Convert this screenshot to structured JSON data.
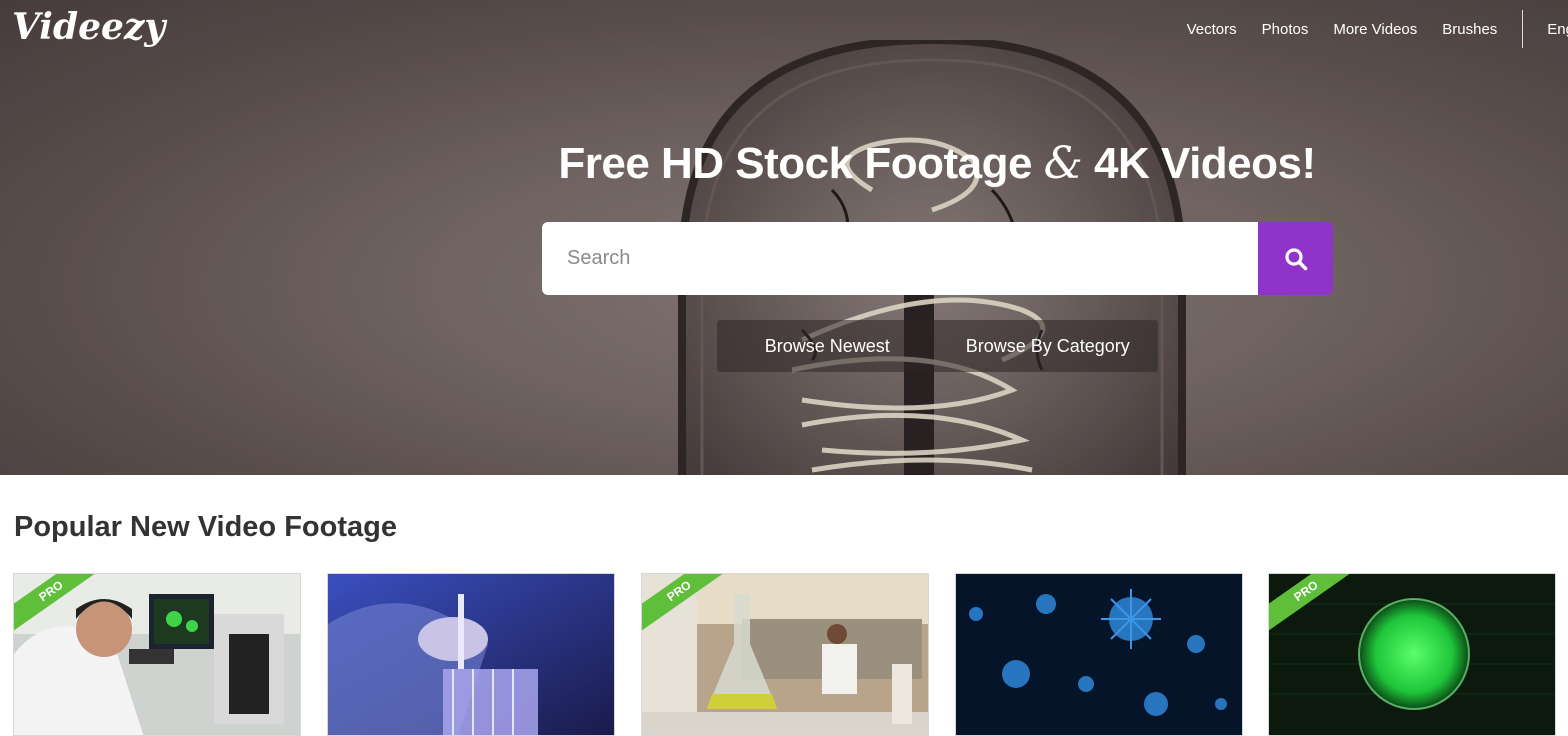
{
  "site": {
    "logo": "Videezy"
  },
  "nav": {
    "links": [
      "Vectors",
      "Photos",
      "More Videos",
      "Brushes"
    ],
    "language": "Eng"
  },
  "hero": {
    "headline_pre": "Free HD Stock Footage ",
    "headline_amp": "&",
    "headline_post": " 4K Videos!",
    "search_placeholder": "Search",
    "browse_newest": "Browse Newest",
    "browse_category": "Browse By Category"
  },
  "section": {
    "title": "Popular New Video Footage",
    "thumbnails": [
      {
        "subject": "scientist at microscope",
        "badge": "PRO"
      },
      {
        "subject": "pipette into test tubes",
        "badge": ""
      },
      {
        "subject": "laboratory flask",
        "badge": "PRO"
      },
      {
        "subject": "blue virus particles",
        "badge": ""
      },
      {
        "subject": "green cell sphere",
        "badge": "PRO"
      }
    ]
  },
  "colors": {
    "accent": "#8f33c9",
    "pro_badge": "#5fbf3a"
  },
  "icons": [
    "search-icon"
  ]
}
